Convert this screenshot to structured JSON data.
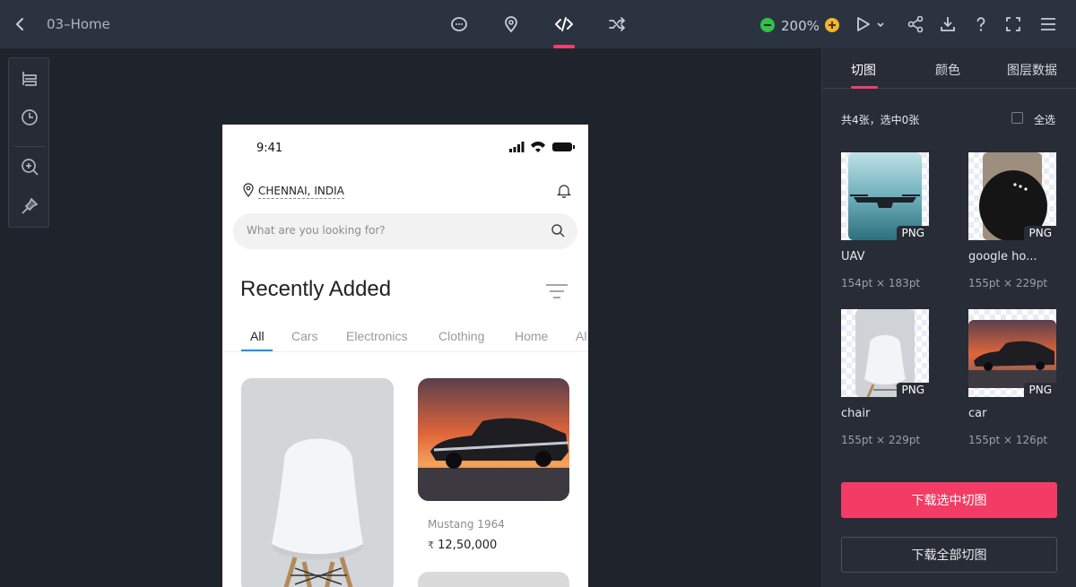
{
  "topbar": {
    "title": "03–Home",
    "zoom": "200%",
    "colors": {
      "accent": "#ef3f6b",
      "zoom_out": "#31c14b",
      "zoom_in": "#f3b52c"
    },
    "center_icons": [
      "comment-icon",
      "location-pin-icon",
      "code-icon",
      "shuffle-icon"
    ],
    "right_icons": [
      "play-icon",
      "share-icon",
      "download-icon",
      "help-icon",
      "fullscreen-icon",
      "menu-icon"
    ]
  },
  "toolstrip": {
    "icons": [
      "layers-icon",
      "history-icon",
      "zoom-icon",
      "pin-icon"
    ]
  },
  "phone": {
    "time": "9:41",
    "location": "CHENNAI, INDIA",
    "search_placeholder": "What are you looking for?",
    "section_title": "Recently Added",
    "tabs": [
      "All",
      "Cars",
      "Electronics",
      "Clothing",
      "Home",
      "Al"
    ],
    "active_tab": "All",
    "car_card": {
      "name": "Mustang 1964",
      "price": "12,50,000",
      "currency": "₹"
    }
  },
  "panel": {
    "tabs": [
      "切图",
      "颜色",
      "图层数据"
    ],
    "active_tab": "切图",
    "count_text": "共4张，选中0张",
    "select_all": "全选",
    "assets": [
      {
        "name": "UAV",
        "size": "154pt × 183pt",
        "format": "PNG"
      },
      {
        "name": "google ho...",
        "size": "155pt × 229pt",
        "format": "PNG"
      },
      {
        "name": "chair",
        "size": "155pt × 229pt",
        "format": "PNG"
      },
      {
        "name": "car",
        "size": "155pt × 126pt",
        "format": "PNG"
      }
    ],
    "download_selected": "下载选中切图",
    "download_all": "下载全部切图"
  }
}
